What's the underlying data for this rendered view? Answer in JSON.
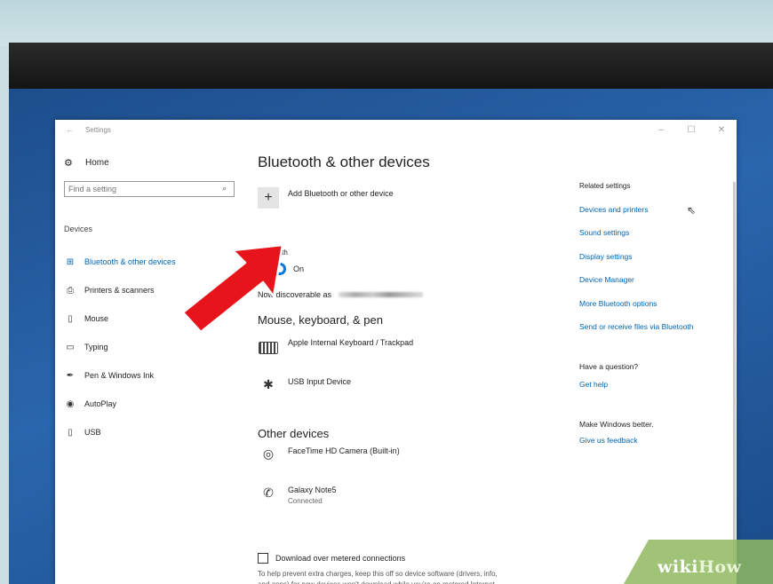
{
  "window": {
    "title": "Settings",
    "controls": [
      "–",
      "☐",
      "✕"
    ]
  },
  "sidebar": {
    "home_label": "Home",
    "search_placeholder": "Find a setting",
    "section_header": "Devices",
    "items": [
      {
        "label": "Bluetooth & other devices",
        "icon": "bluetooth-devices-icon",
        "active": true
      },
      {
        "label": "Printers & scanners",
        "icon": "printer-icon",
        "active": false
      },
      {
        "label": "Mouse",
        "icon": "mouse-icon",
        "active": false
      },
      {
        "label": "Typing",
        "icon": "keyboard-icon",
        "active": false
      },
      {
        "label": "Pen & Windows Ink",
        "icon": "pen-icon",
        "active": false
      },
      {
        "label": "AutoPlay",
        "icon": "autoplay-icon",
        "active": false
      },
      {
        "label": "USB",
        "icon": "usb-icon",
        "active": false
      }
    ]
  },
  "main": {
    "title": "Bluetooth & other devices",
    "add_device_label": "Add Bluetooth or other device",
    "bluetooth_label": "Bluetooth",
    "bluetooth_state": "On",
    "discoverable_label": "Now discoverable as",
    "mouse_section_title": "Mouse, keyboard, & pen",
    "mouse_devices": [
      {
        "name": "Apple Internal Keyboard / Trackpad",
        "icon": "keyboard-icon"
      },
      {
        "name": "USB Input Device",
        "icon": "bluetooth-icon"
      }
    ],
    "other_section_title": "Other devices",
    "other_devices": [
      {
        "name": "FaceTime HD Camera (Built-in)",
        "status": "",
        "icon": "webcam-icon"
      },
      {
        "name": "Galaxy Note5",
        "status": "Connected",
        "icon": "phone-icon"
      }
    ],
    "metered_checkbox_label": "Download over metered connections",
    "metered_help": "To help prevent extra charges, keep this off so device software (drivers, info, and apps) for new devices won't download while you're on metered Internet connections."
  },
  "related": {
    "header": "Related settings",
    "links": [
      "Devices and printers",
      "Sound settings",
      "Display settings",
      "Device Manager",
      "More Bluetooth options",
      "Send or receive files via Bluetooth"
    ],
    "question_header": "Have a question?",
    "help_link": "Get help",
    "feedback_header": "Make Windows better.",
    "feedback_link": "Give us feedback"
  },
  "watermark": {
    "wiki": "wiki",
    "how": "How"
  },
  "colors": {
    "accent": "#0078d7",
    "link": "#0063b1",
    "arrow": "#e8141b",
    "desktop": "#1d4e8c"
  }
}
